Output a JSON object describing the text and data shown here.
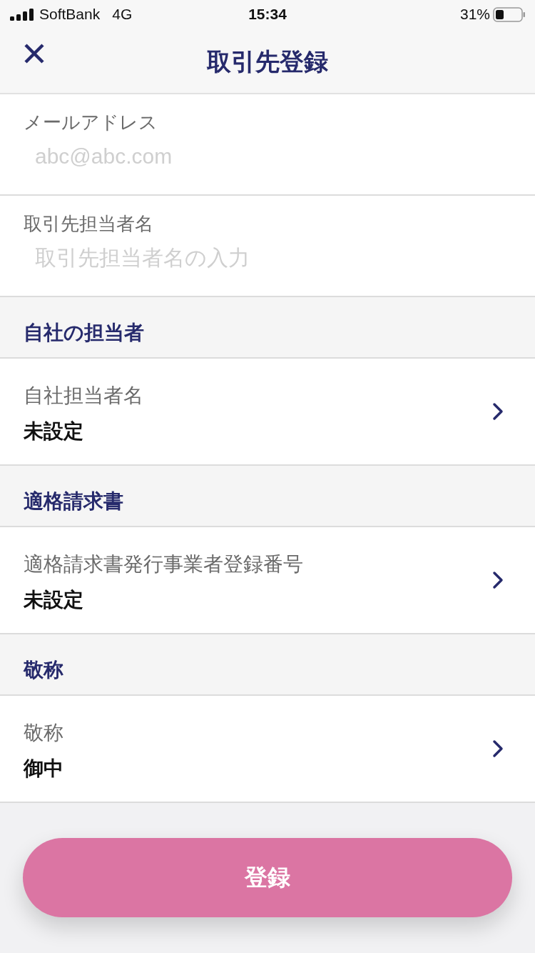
{
  "status_bar": {
    "carrier": "SoftBank",
    "network": "4G",
    "time": "15:34",
    "battery": "31%"
  },
  "nav": {
    "title": "取引先登録"
  },
  "fields": [
    {
      "label": "メールアドレス",
      "placeholder": "abc@abc.com"
    },
    {
      "label": "取引先担当者名",
      "placeholder": "取引先担当者名の入力"
    }
  ],
  "sections": [
    {
      "header": "自社の担当者",
      "row": {
        "label": "自社担当者名",
        "value": "未設定"
      }
    },
    {
      "header": "適格請求書",
      "row": {
        "label": "適格請求書発行事業者登録番号",
        "value": "未設定"
      }
    },
    {
      "header": "敬称",
      "row": {
        "label": "敬称",
        "value": "御中"
      }
    }
  ],
  "submit_button": "登録"
}
